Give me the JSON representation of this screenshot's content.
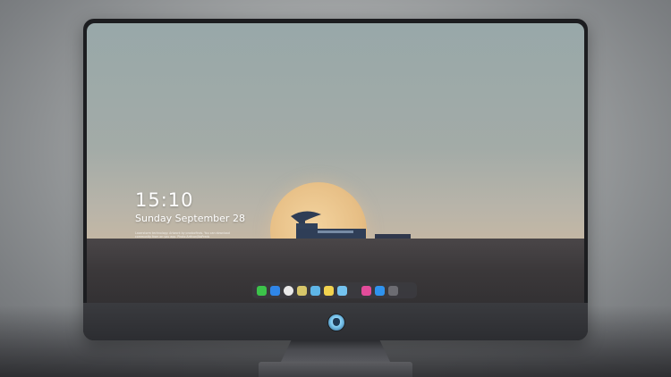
{
  "lockscreen": {
    "time": "15:10",
    "date": "Sunday September 28",
    "credit": "Laserstorm technology. Artwork by prodocfinds. You can download community from on you app. Photo Artfcon/NoPreds"
  },
  "dock": {
    "icons": [
      {
        "name": "messages-icon",
        "color": "#3cc34a"
      },
      {
        "name": "mail-icon",
        "color": "#2f86e8"
      },
      {
        "name": "clock-icon",
        "color": "#e9e9e9"
      },
      {
        "name": "notes-icon",
        "color": "#d7c66a"
      },
      {
        "name": "finder-icon",
        "color": "#5fb6e8"
      },
      {
        "name": "stickies-icon",
        "color": "#f2d34f"
      },
      {
        "name": "photos-icon",
        "color": "#74c3f0"
      },
      {
        "name": "music-icon",
        "color": "#e24c9a"
      },
      {
        "name": "app-store-icon",
        "color": "#2f93ee"
      },
      {
        "name": "camera-icon",
        "color": "#6c6c72"
      }
    ]
  }
}
